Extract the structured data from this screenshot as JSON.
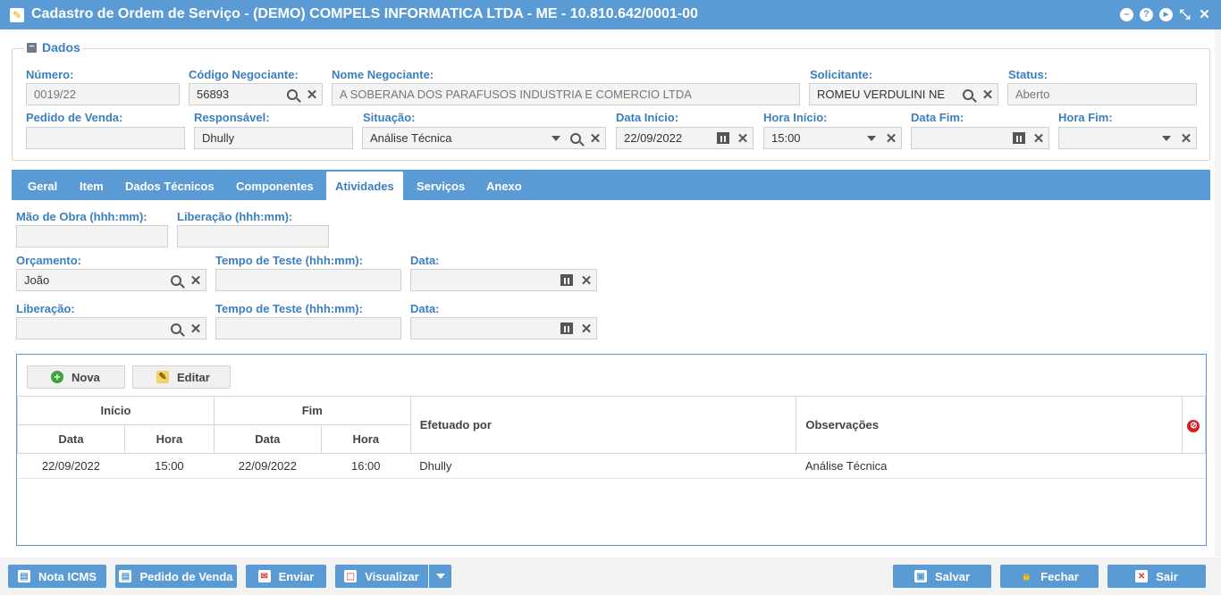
{
  "window": {
    "title": "Cadastro de Ordem de Serviço - (DEMO) COMPELS INFORMATICA LTDA - ME - 10.810.642/0001-00"
  },
  "dados": {
    "legend": "Dados",
    "numero_label": "Número:",
    "numero_value": "0019/22",
    "codigo_label": "Código Negociante:",
    "codigo_value": "56893",
    "nome_label": "Nome Negociante:",
    "nome_value": "A SOBERANA DOS PARAFUSOS INDUSTRIA E COMERCIO LTDA",
    "solicitante_label": "Solicitante:",
    "solicitante_value": "ROMEU VERDULINI NE",
    "status_label": "Status:",
    "status_value": "Aberto",
    "pedido_label": "Pedido de Venda:",
    "pedido_value": "",
    "responsavel_label": "Responsável:",
    "responsavel_value": "Dhully",
    "situacao_label": "Situação:",
    "situacao_value": "Análise Técnica",
    "data_inicio_label": "Data Início:",
    "data_inicio_value": "22/09/2022",
    "hora_inicio_label": "Hora Início:",
    "hora_inicio_value": "15:00",
    "data_fim_label": "Data Fim:",
    "data_fim_value": "",
    "hora_fim_label": "Hora Fim:",
    "hora_fim_value": ""
  },
  "tabs": [
    {
      "label": "Geral"
    },
    {
      "label": "Item"
    },
    {
      "label": "Dados Técnicos"
    },
    {
      "label": "Componentes"
    },
    {
      "label": "Atividades"
    },
    {
      "label": "Serviços"
    },
    {
      "label": "Anexo"
    }
  ],
  "atividades": {
    "mao_obra_label": "Mão de Obra (hhh:mm):",
    "mao_obra_value": "",
    "liberacao_hhh_label": "Liberação (hhh:mm):",
    "liberacao_hhh_value": "",
    "orcamento_label": "Orçamento:",
    "orcamento_value": "João",
    "tempo_teste1_label": "Tempo de Teste (hhh:mm):",
    "tempo_teste1_value": "",
    "data1_label": "Data:",
    "data1_value": "",
    "liberacao_label": "Liberação:",
    "liberacao_value": "",
    "tempo_teste2_label": "Tempo de Teste (hhh:mm):",
    "tempo_teste2_value": "",
    "data2_label": "Data:",
    "data2_value": ""
  },
  "grid": {
    "nova_label": "Nova",
    "editar_label": "Editar",
    "h_inicio": "Início",
    "h_fim": "Fim",
    "h_data": "Data",
    "h_hora": "Hora",
    "h_efetuado": "Efetuado por",
    "h_obs": "Observações",
    "rows": [
      {
        "ini_data": "22/09/2022",
        "ini_hora": "15:00",
        "fim_data": "22/09/2022",
        "fim_hora": "16:00",
        "efetuado": "Dhully",
        "obs": "Análise Técnica"
      }
    ]
  },
  "footer": {
    "nota_icms": "Nota ICMS",
    "pedido_venda": "Pedido de Venda",
    "enviar": "Enviar",
    "visualizar": "Visualizar",
    "salvar": "Salvar",
    "fechar": "Fechar",
    "sair": "Sair"
  },
  "colors": {
    "accent": "#5b9bd5",
    "label": "#3a7fc1"
  }
}
